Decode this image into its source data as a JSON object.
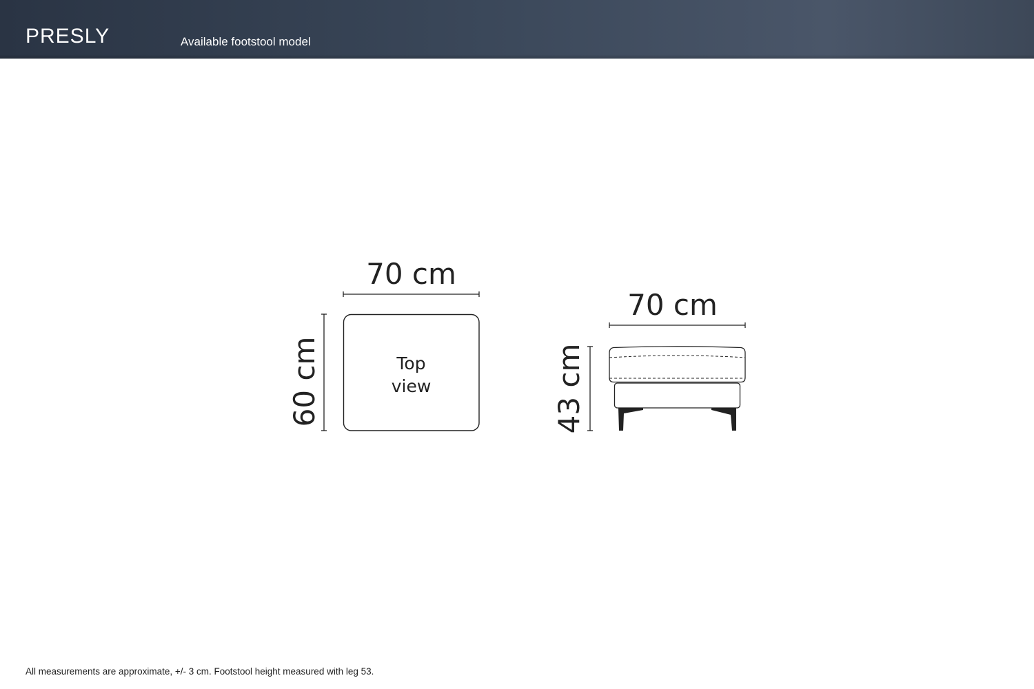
{
  "header": {
    "brand": "PRESLY",
    "subtitle": "Available footstool model",
    "background_color": "#3a4759"
  },
  "top_view": {
    "width_label": "70 cm",
    "depth_label": "60 cm",
    "caption_line1": "Top",
    "caption_line2": "view"
  },
  "side_view": {
    "width_label": "70 cm",
    "height_label": "43 cm"
  },
  "footnote": "All measurements are approximate, +/- 3 cm. Footstool height measured with leg 53."
}
